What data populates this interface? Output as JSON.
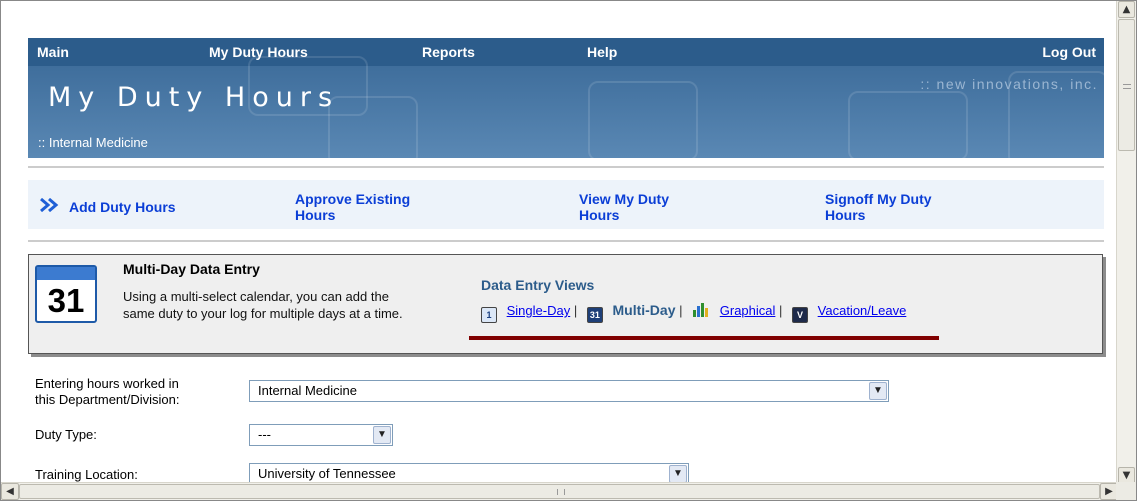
{
  "nav": {
    "main": "Main",
    "my_duty_hours": "My Duty Hours",
    "reports": "Reports",
    "help": "Help",
    "logout": "Log Out"
  },
  "banner": {
    "title": "My Duty Hours",
    "department": ":: Internal Medicine",
    "company": ":: new innovations, inc."
  },
  "actions": {
    "add": "Add Duty Hours",
    "approve_line1": "Approve Existing",
    "approve_line2": "Hours",
    "view_line1": "View My Duty",
    "view_line2": "Hours",
    "signoff_line1": "Signoff My Duty",
    "signoff_line2": "Hours"
  },
  "panel": {
    "calendar_number": "31",
    "title": "Multi-Day Data Entry",
    "description": "Using a multi-select calendar, you can add the same duty to your log for multiple days at a time.",
    "views_label": "Data Entry Views",
    "views": {
      "single_icon": "1",
      "single": "Single-Day",
      "multi_icon": "31",
      "multi": "Multi-Day",
      "graphical": "Graphical",
      "vacation_icon": "V",
      "vacation": "Vacation/Leave",
      "sep": "|"
    }
  },
  "form": {
    "dept_label_line1": "Entering hours worked in",
    "dept_label_line2": "this Department/Division:",
    "dept_value": "Internal Medicine",
    "duty_label": "Duty Type:",
    "duty_value": "---",
    "location_label": "Training Location:",
    "location_value": "University of Tennessee"
  },
  "colors": {
    "nav_bg": "#2c5c8b",
    "link": "#0b3ed6",
    "accent_line": "#800000"
  },
  "icons": {
    "chevron": "double-chevron-right-icon",
    "calendar": "calendar-icon",
    "graph": "bar-chart-icon",
    "dropdown": "chevron-down-icon"
  }
}
